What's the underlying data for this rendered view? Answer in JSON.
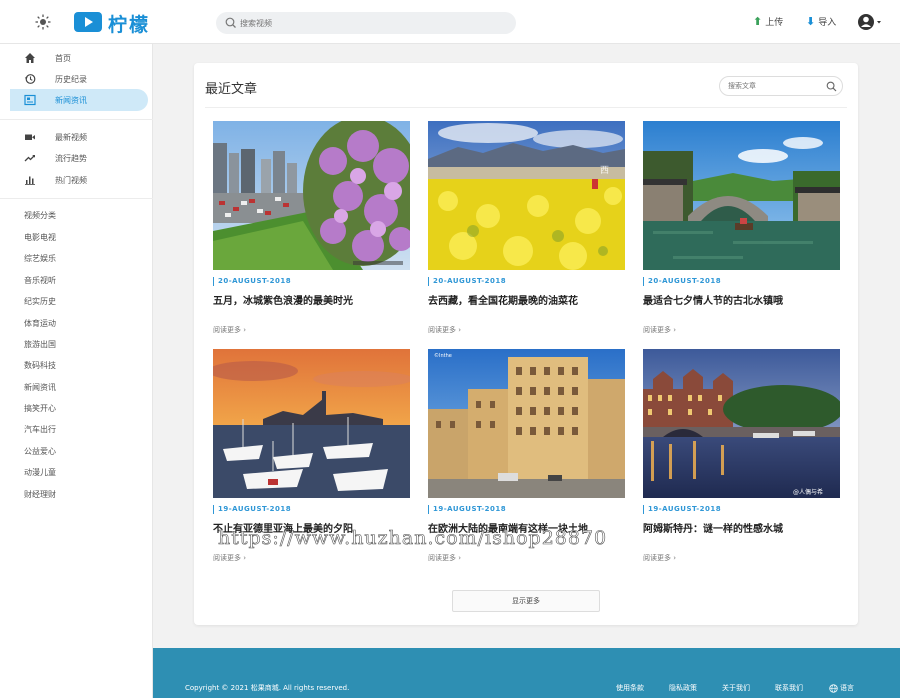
{
  "header": {
    "logo_text": "柠檬",
    "search_placeholder": "搜索视频",
    "upload_label": "上传",
    "import_label": "导入"
  },
  "sidebar": {
    "main_items": [
      {
        "label": "首页",
        "icon": "home-icon"
      },
      {
        "label": "历史纪录",
        "icon": "history-icon"
      },
      {
        "label": "新闻资讯",
        "icon": "news-icon",
        "active": true
      }
    ],
    "video_items": [
      {
        "label": "最新视频",
        "icon": "video-camera-icon"
      },
      {
        "label": "流行趋势",
        "icon": "trending-icon"
      },
      {
        "label": "热门视频",
        "icon": "bar-chart-icon"
      }
    ],
    "categories_title": "视频分类",
    "categories": [
      "电影电视",
      "综艺娱乐",
      "音乐视听",
      "纪实历史",
      "体育运动",
      "旅游出国",
      "数码科技",
      "新闻资讯",
      "搞笑开心",
      "汽车出行",
      "公益爱心",
      "动漫儿童",
      "财经理财"
    ]
  },
  "main": {
    "title": "最近文章",
    "search_placeholder": "搜索文章",
    "articles": [
      {
        "date": "20-AUGUST-2018",
        "title": "五月，冰城紫色浪漫的最美时光",
        "more": "阅读更多 ›"
      },
      {
        "date": "20-AUGUST-2018",
        "title": "去西藏，看全国花期最晚的油菜花",
        "more": "阅读更多 ›"
      },
      {
        "date": "20-AUGUST-2018",
        "title": "最适合七夕情人节的古北水镇哦",
        "more": "阅读更多 ›"
      },
      {
        "date": "19-AUGUST-2018",
        "title": "不止有亚德里亚海上最美的夕阳",
        "more": "阅读更多 ›"
      },
      {
        "date": "19-AUGUST-2018",
        "title": "在欧洲大陆的最南端有这样一块土地",
        "more": "阅读更多 ›"
      },
      {
        "date": "19-AUGUST-2018",
        "title": "阿姆斯特丹：谜一样的性感水城",
        "more": "阅读更多 ›"
      }
    ],
    "show_more_label": "显示更多"
  },
  "footer": {
    "copyright": "Copyright © 2021 松果商城. All rights reserved.",
    "links": [
      "使用条款",
      "隐私政策",
      "关于我们",
      "联系我们",
      "语言"
    ]
  },
  "watermark": "https://www.huzhan.com/ishop28870",
  "colors": {
    "accent": "#1a8fd6",
    "footer": "#2e8fb3",
    "active_bg": "#cfe9f8"
  }
}
